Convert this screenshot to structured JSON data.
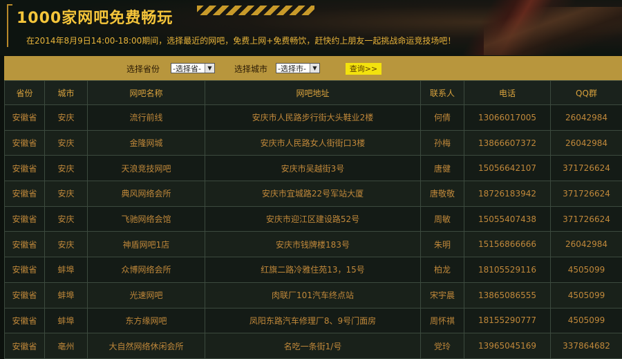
{
  "header": {
    "title": "1000家网吧免费畅玩",
    "subtitle": "在2014年8月9日14:00-18:00期间，选择最近的网吧，免费上网+免费畅饮，赶快约上朋友一起挑战命运竞技场吧！"
  },
  "search": {
    "province_label": "选择省份",
    "province_value": "-选择省-",
    "city_label": "选择城市",
    "city_value": "-选择市-",
    "query_button": "查询>>"
  },
  "table": {
    "headers": [
      "省份",
      "城市",
      "网吧名称",
      "网吧地址",
      "联系人",
      "电话",
      "QQ群"
    ],
    "rows": [
      [
        "安徽省",
        "安庆",
        "流行前线",
        "安庆市人民路步行街大头鞋业2楼",
        "何倩",
        "13066017005",
        "26042984"
      ],
      [
        "安徽省",
        "安庆",
        "金隆网城",
        "安庆市人民路女人街街口3楼",
        "孙梅",
        "13866607372",
        "26042984"
      ],
      [
        "安徽省",
        "安庆",
        "天浪竞技网吧",
        "安庆市吴越街3号",
        "唐健",
        "15056642107",
        "371726624"
      ],
      [
        "安徽省",
        "安庆",
        "典风网络会所",
        "安庆市宜城路22号军站大厦",
        "唐敬敬",
        "18726183942",
        "371726624"
      ],
      [
        "安徽省",
        "安庆",
        "飞驰网络会馆",
        "安庆市迎江区建设路52号",
        "周敏",
        "15055407438",
        "371726624"
      ],
      [
        "安徽省",
        "安庆",
        "神盾网吧1店",
        "安庆市钱牌楼183号",
        "朱明",
        "15156866666",
        "26042984"
      ],
      [
        "安徽省",
        "蚌埠",
        "众博网络会所",
        "红旗二路冷雅住苑13，15号",
        "柏龙",
        "18105529116",
        "4505099"
      ],
      [
        "安徽省",
        "蚌埠",
        "光速网吧",
        "肉联厂101汽车终点站",
        "宋宇晨",
        "13865086555",
        "4505099"
      ],
      [
        "安徽省",
        "蚌埠",
        "东方缘网吧",
        "凤阳东路汽车修理厂8、9号门面房",
        "周怀祺",
        "18155290777",
        "4505099"
      ],
      [
        "安徽省",
        "亳州",
        "大自然网络休闲会所",
        "名吃一条街1/号",
        "党玲",
        "13965045169",
        "337864682"
      ]
    ]
  }
}
